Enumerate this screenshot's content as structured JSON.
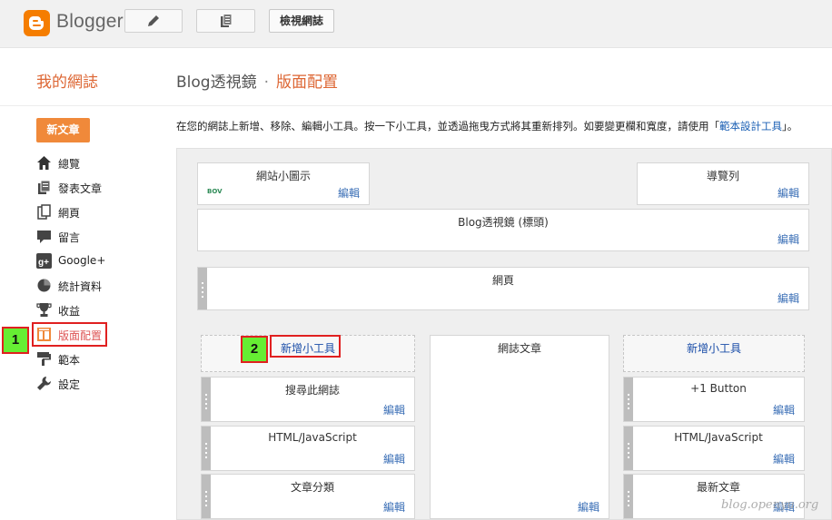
{
  "app": {
    "name": "Blogger"
  },
  "toolbar": {
    "view_blog_label": "檢視網誌",
    "pencil_icon": "pencil-icon",
    "posts_icon": "posts-icon"
  },
  "header": {
    "my_blog": "我的網誌",
    "breadcrumb": {
      "blog": "Blog透視鏡",
      "separator": "·",
      "current": "版面配置"
    }
  },
  "sidebar": {
    "new_post_label": "新文章",
    "items": [
      {
        "label": "總覽",
        "icon": "home-icon"
      },
      {
        "label": "發表文章",
        "icon": "posts-icon"
      },
      {
        "label": "網頁",
        "icon": "pages-icon"
      },
      {
        "label": "留言",
        "icon": "comment-icon"
      },
      {
        "label": "Google+",
        "icon": "google-plus-icon"
      },
      {
        "label": "統計資料",
        "icon": "stats-icon"
      },
      {
        "label": "收益",
        "icon": "trophy-icon"
      },
      {
        "label": "版面配置",
        "icon": "layout-icon",
        "active": true
      },
      {
        "label": "範本",
        "icon": "template-icon"
      },
      {
        "label": "設定",
        "icon": "wrench-icon"
      }
    ]
  },
  "description": {
    "text": "在您的網誌上新增、移除、編輯小工具。按一下小工具，並透過拖曳方式將其重新排列。如要變更欄和寬度，請使用「",
    "link": "範本設計工具",
    "suffix": "」。"
  },
  "layout": {
    "edit_label": "編輯",
    "favicon": {
      "title": "網站小圖示",
      "thumb_text": "BOV"
    },
    "navbar": {
      "title": "導覽列"
    },
    "header": {
      "title": "Blog透視鏡 (標頭)"
    },
    "pages": {
      "title": "網頁"
    },
    "main": {
      "title": "網誌文章"
    },
    "left_column": {
      "add_gadget": "新增小工具",
      "gadgets": [
        "搜尋此網誌",
        "HTML/JavaScript",
        "文章分類"
      ]
    },
    "right_column": {
      "add_gadget": "新增小工具",
      "gadgets": [
        "+1 Button",
        "HTML/JavaScript",
        "最新文章"
      ]
    }
  },
  "annotations": {
    "marker_1": "1",
    "marker_2": "2"
  },
  "watermark": "blog.openyu.org",
  "colors": {
    "accent": "#dd6633",
    "new_post_bg": "#f0893a",
    "link": "#3b6fb6",
    "callout": "#e02020",
    "marker": "#66ee33"
  }
}
